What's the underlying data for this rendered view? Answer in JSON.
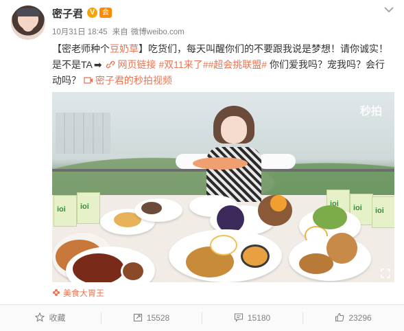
{
  "post": {
    "username": "密子君",
    "badge_v": "V",
    "badge_level": "会",
    "date": "10月31日 18:45",
    "via_prefix": "来自",
    "via": "微博weibo.com",
    "text": {
      "p1": "【密老师种个",
      "link1": "豆奶草",
      "p2": "】吃货们，每天叫醒你们的不要跟我说是梦想！请你诚实！是不是TA",
      "arrow": "➡",
      "link2": "网页链接",
      "tag1": "#双11来了#",
      "tag2": "#超会挑联盟#",
      "p3": " 你们爱我吗？宠我吗？会行动吗？",
      "video_link": "密子君的秒拍视频"
    },
    "video": {
      "watermark": "秒拍",
      "carton_text": "ioi"
    },
    "source": "美食大胃王"
  },
  "actions": {
    "favorite": "收藏",
    "repost": "15528",
    "comment": "15180",
    "like": "23296"
  }
}
